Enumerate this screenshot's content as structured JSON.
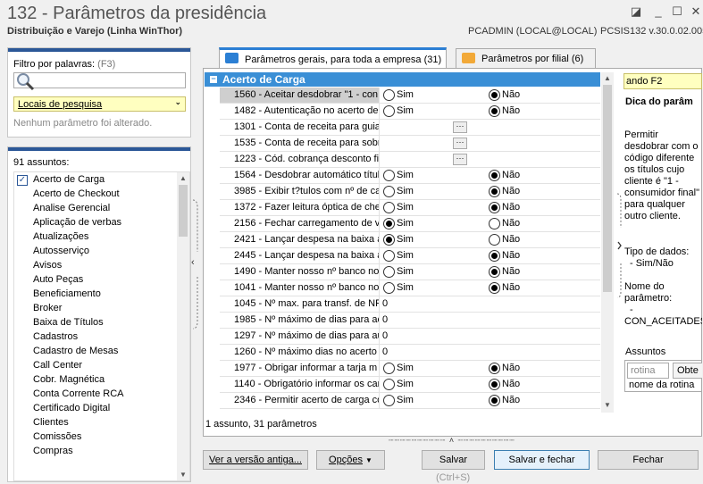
{
  "window": {
    "title": "132 - Parâmetros da presidência",
    "subtitle": "Distribuição e Varejo (Linha WinThor)",
    "user": "PCADMIN (LOCAL@LOCAL)",
    "version": "PCSIS132  v.30.0.02.005",
    "controls": [
      "restore-icon",
      "minimize-icon",
      "maximize-icon",
      "close-icon"
    ]
  },
  "filter": {
    "label": "Filtro por palavras:",
    "shortcut": "(F3)",
    "search_value": "",
    "locais": "Locais de pesquisa",
    "status": "Nenhum parâmetro foi alterado."
  },
  "assuntos": {
    "count_label": "91 assuntos:",
    "items": [
      "Acerto de Carga",
      "Acerto de Checkout",
      "Analise Gerencial",
      "Aplicação de verbas",
      "Atualizações",
      "Autosserviço",
      "Avisos",
      "Auto Peças",
      "Beneficiamento",
      "Broker",
      "Baixa de Títulos",
      "Cadastros",
      "Cadastro de Mesas",
      "Call Center",
      "Cobr. Magnética",
      "Conta Corrente RCA",
      "Certificado Digital",
      "Clientes",
      "Comissões",
      "Compras"
    ],
    "checked_index": 0
  },
  "tabs": [
    {
      "label": "Parâmetros gerais, para toda a empresa",
      "count": "(31)",
      "active": true,
      "color": "#2b7fd4"
    },
    {
      "label": "Parâmetros por filial",
      "count": "(6)",
      "active": false,
      "color": "#f2a938"
    }
  ],
  "grid": {
    "group": "Acerto de Carga",
    "sim": "Sim",
    "nao": "Não",
    "rows": [
      {
        "name": "1560 - Aceitar desdobrar \"1 - con",
        "type": "radio",
        "value": "nao",
        "selected": true
      },
      {
        "name": "1482 - Autenticação no acerto de",
        "type": "radio",
        "value": "nao"
      },
      {
        "name": "1301 - Conta de receita para guia",
        "type": "lookup"
      },
      {
        "name": "1535 - Conta de receita para sobr",
        "type": "lookup"
      },
      {
        "name": "1223 - Cód. cobrança desconto fi",
        "type": "lookup"
      },
      {
        "name": "1564 - Desdobrar automático títul",
        "type": "radio",
        "value": "nao"
      },
      {
        "name": "3985 - Exibir t?tulos com nº de ca",
        "type": "radio",
        "value": "nao"
      },
      {
        "name": "1372 - Fazer leitura óptica de che",
        "type": "radio",
        "value": "nao"
      },
      {
        "name": "2156 - Fechar carregamento de v",
        "type": "radio",
        "value": "sim"
      },
      {
        "name": "2421 - Lançar despesa na baixa a",
        "type": "radio",
        "value": "sim"
      },
      {
        "name": "2445 - Lançar despesa na baixa a",
        "type": "radio",
        "value": "nao"
      },
      {
        "name": "1490 - Manter nosso nº banco no",
        "type": "radio",
        "value": "nao"
      },
      {
        "name": "1041 - Manter nosso nº banco no",
        "type": "radio",
        "value": "nao"
      },
      {
        "name": "1045 - Nº max. para transf. de NF",
        "type": "number",
        "value": "0"
      },
      {
        "name": "1985 - Nº máximo de dias para ac",
        "type": "number",
        "value": "0"
      },
      {
        "name": "1297 - Nº máximo de dias para au",
        "type": "number",
        "value": "0"
      },
      {
        "name": "1260 - Nº máximo dias no acerto c",
        "type": "number",
        "value": "0"
      },
      {
        "name": "1977 - Obrigar informar a tarja m",
        "type": "radio",
        "value": "nao"
      },
      {
        "name": "1140 - Obrigatório informar os car",
        "type": "radio",
        "value": "nao"
      },
      {
        "name": "2346 - Permitir acerto de carga co",
        "type": "radio",
        "value": "nao"
      }
    ],
    "footer": "1 assunto, 31 parâmetros"
  },
  "help": {
    "header": "ando F2",
    "title": "Dica do parâm",
    "description": "Permitir desdobrar com o código diferente os títulos cujo cliente é \"1 - consumidor final\" para qualquer outro cliente.",
    "type_label": "Tipo de dados:",
    "type_value": "- Sim/Não",
    "name_label": "Nome do parâmetro:",
    "name_dash": "-",
    "name_value": "CON_ACEITADES",
    "assuntos_label": "Assuntos",
    "rotina_placeholder": "rotina",
    "obter": "Obte",
    "rotina_label": "nome da rotina"
  },
  "buttons": {
    "versao": "Ver a versão antiga...",
    "opcoes": "Opções",
    "salvar": "Salvar",
    "salvar_fechar": "Salvar e fechar",
    "fechar": "Fechar",
    "ctrl_s": "(Ctrl+S)"
  }
}
